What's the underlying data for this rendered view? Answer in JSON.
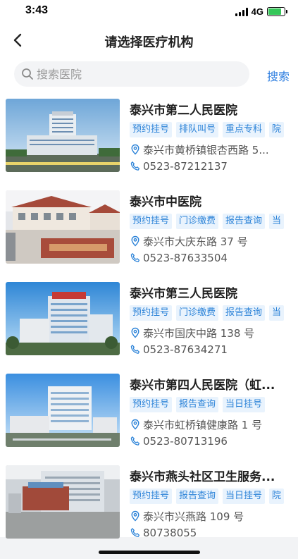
{
  "status_bar": {
    "time": "3:43",
    "network": "4G",
    "battery_level": 0.8
  },
  "header": {
    "title": "请选择医疗机构",
    "back_icon": "chevron-left-icon"
  },
  "search": {
    "placeholder": "搜索医院",
    "value": "",
    "button_label": "搜索",
    "icon": "search-icon"
  },
  "colors": {
    "accent": "#2f7fe0",
    "tag_bg": "#e9f3fd",
    "tag_text": "#2c83d8"
  },
  "hospitals": [
    {
      "name": "泰兴市第二人民医院",
      "tags": [
        "预约挂号",
        "排队叫号",
        "重点专科",
        "院"
      ],
      "address": "泰兴市黄桥镇银杏西路 5...",
      "phone": "0523-87212137"
    },
    {
      "name": "泰兴市中医院",
      "tags": [
        "预约挂号",
        "门诊缴费",
        "报告查询",
        "当"
      ],
      "address": "泰兴市大庆东路 37 号",
      "phone": "0523-87633504"
    },
    {
      "name": "泰兴市第三人民医院",
      "tags": [
        "预约挂号",
        "门诊缴费",
        "报告查询",
        "当"
      ],
      "address": "泰兴市国庆中路 138 号",
      "phone": "0523-87634271"
    },
    {
      "name": "泰兴市第四人民医院（虹...",
      "tags": [
        "预约挂号",
        "报告查询",
        "当日挂号"
      ],
      "address": "泰兴市虹桥镇健康路 1 号",
      "phone": "0523-80713196"
    },
    {
      "name": "泰兴市燕头社区卫生服务...",
      "tags": [
        "预约挂号",
        "报告查询",
        "当日挂号",
        "院"
      ],
      "address": "泰兴市兴燕路 109 号",
      "phone": "80738055"
    }
  ]
}
